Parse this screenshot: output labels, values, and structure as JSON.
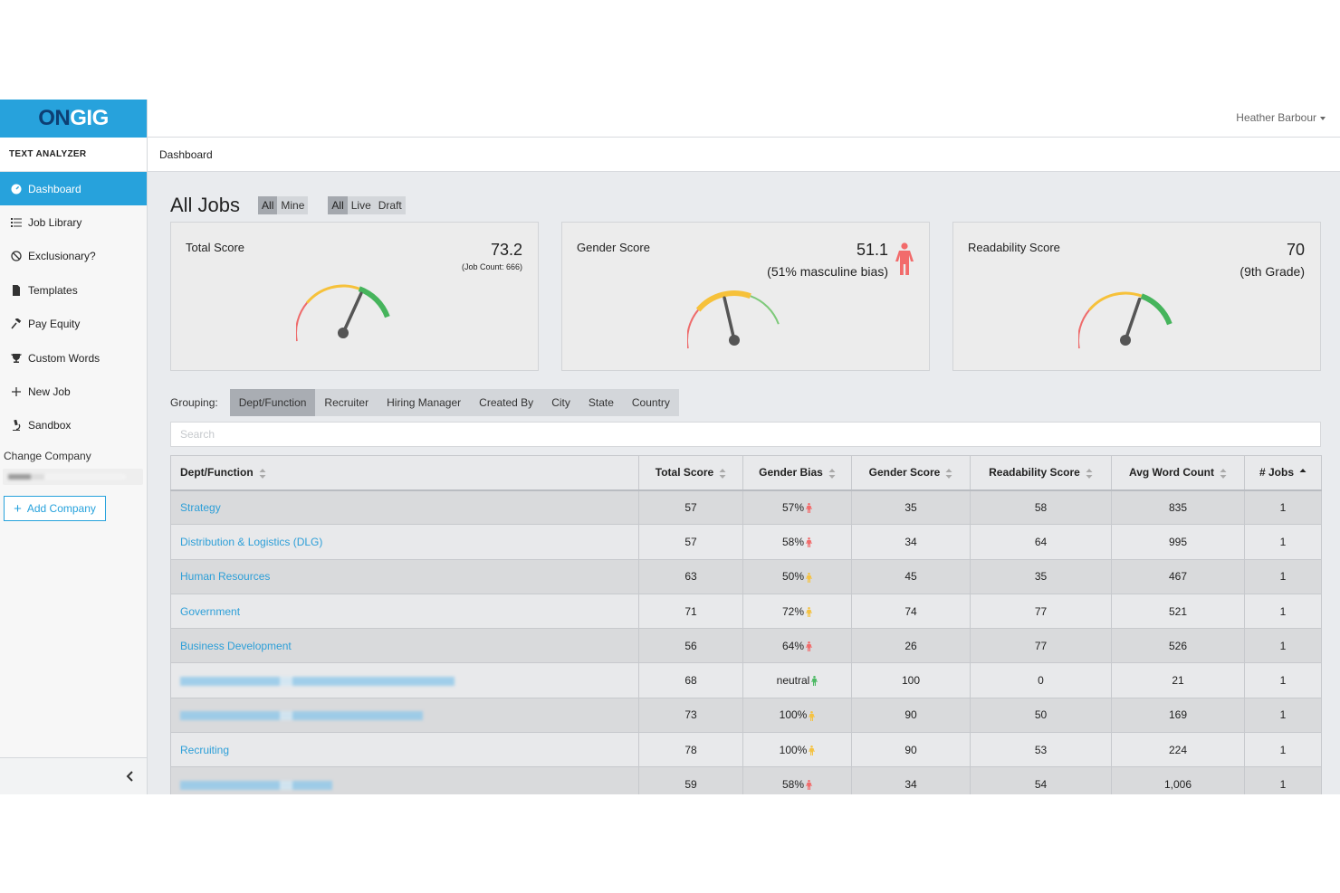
{
  "brand": {
    "on": "ON",
    "gig": "GIG"
  },
  "sidebar": {
    "title": "TEXT ANALYZER",
    "items": [
      {
        "label": "Dashboard",
        "icon": "dashboard-icon"
      },
      {
        "label": "Job Library",
        "icon": "list-icon"
      },
      {
        "label": "Exclusionary?",
        "icon": "ban-icon"
      },
      {
        "label": "Templates",
        "icon": "document-icon"
      },
      {
        "label": "Pay Equity",
        "icon": "gavel-icon"
      },
      {
        "label": "Custom Words",
        "icon": "trophy-icon"
      },
      {
        "label": "New Job",
        "icon": "plus-icon"
      },
      {
        "label": "Sandbox",
        "icon": "microscope-icon"
      }
    ],
    "change_company": "Change Company",
    "add_company": "Add Company"
  },
  "header": {
    "user": "Heather Barbour",
    "breadcrumb": "Dashboard"
  },
  "main": {
    "title": "All Jobs",
    "owner_filter": [
      "All",
      "Mine"
    ],
    "status_filter": [
      "All",
      "Live",
      "Draft"
    ]
  },
  "cards": {
    "total": {
      "label": "Total Score",
      "value": "73.2",
      "sub": "(Job Count: 666)",
      "score": 73.2
    },
    "gender": {
      "label": "Gender Score",
      "value": "51.1",
      "sub": "(51% masculine bias)",
      "score": 51.1,
      "icon": "person-icon",
      "icon_color": "#f26b6b"
    },
    "readability": {
      "label": "Readability Score",
      "value": "70",
      "sub": "(9th Grade)",
      "score": 70
    }
  },
  "grouping": {
    "label": "Grouping:",
    "tabs": [
      "Dept/Function",
      "Recruiter",
      "Hiring Manager",
      "Created By",
      "City",
      "State",
      "Country"
    ]
  },
  "search": {
    "placeholder": "Search"
  },
  "table": {
    "columns": [
      "Dept/Function",
      "Total Score",
      "Gender Bias",
      "Gender Score",
      "Readability Score",
      "Avg Word Count",
      "# Jobs"
    ],
    "rows": [
      {
        "name": "Strategy",
        "total": "57",
        "bias": "57%",
        "bias_color": "#f26b6b",
        "gender": "35",
        "readability": "58",
        "words": "835",
        "jobs": "1"
      },
      {
        "name": "Distribution & Logistics (DLG)",
        "total": "57",
        "bias": "58%",
        "bias_color": "#f26b6b",
        "gender": "34",
        "readability": "64",
        "words": "995",
        "jobs": "1"
      },
      {
        "name": "Human Resources",
        "total": "63",
        "bias": "50%",
        "bias_color": "#f5c242",
        "gender": "45",
        "readability": "35",
        "words": "467",
        "jobs": "1"
      },
      {
        "name": "Government",
        "total": "71",
        "bias": "72%",
        "bias_color": "#f5c242",
        "gender": "74",
        "readability": "77",
        "words": "521",
        "jobs": "1"
      },
      {
        "name": "Business Development",
        "total": "56",
        "bias": "64%",
        "bias_color": "#f26b6b",
        "gender": "26",
        "readability": "77",
        "words": "526",
        "jobs": "1"
      },
      {
        "name": "",
        "total": "68",
        "bias": "neutral",
        "bias_color": "#4cb963",
        "gender": "100",
        "readability": "0",
        "words": "21",
        "jobs": "1"
      },
      {
        "name": "",
        "total": "73",
        "bias": "100%",
        "bias_color": "#f5c242",
        "gender": "90",
        "readability": "50",
        "words": "169",
        "jobs": "1"
      },
      {
        "name": "Recruiting",
        "total": "78",
        "bias": "100%",
        "bias_color": "#f5c242",
        "gender": "90",
        "readability": "53",
        "words": "224",
        "jobs": "1"
      },
      {
        "name": "",
        "total": "59",
        "bias": "58%",
        "bias_color": "#f26b6b",
        "gender": "34",
        "readability": "54",
        "words": "1,006",
        "jobs": "1"
      }
    ]
  }
}
